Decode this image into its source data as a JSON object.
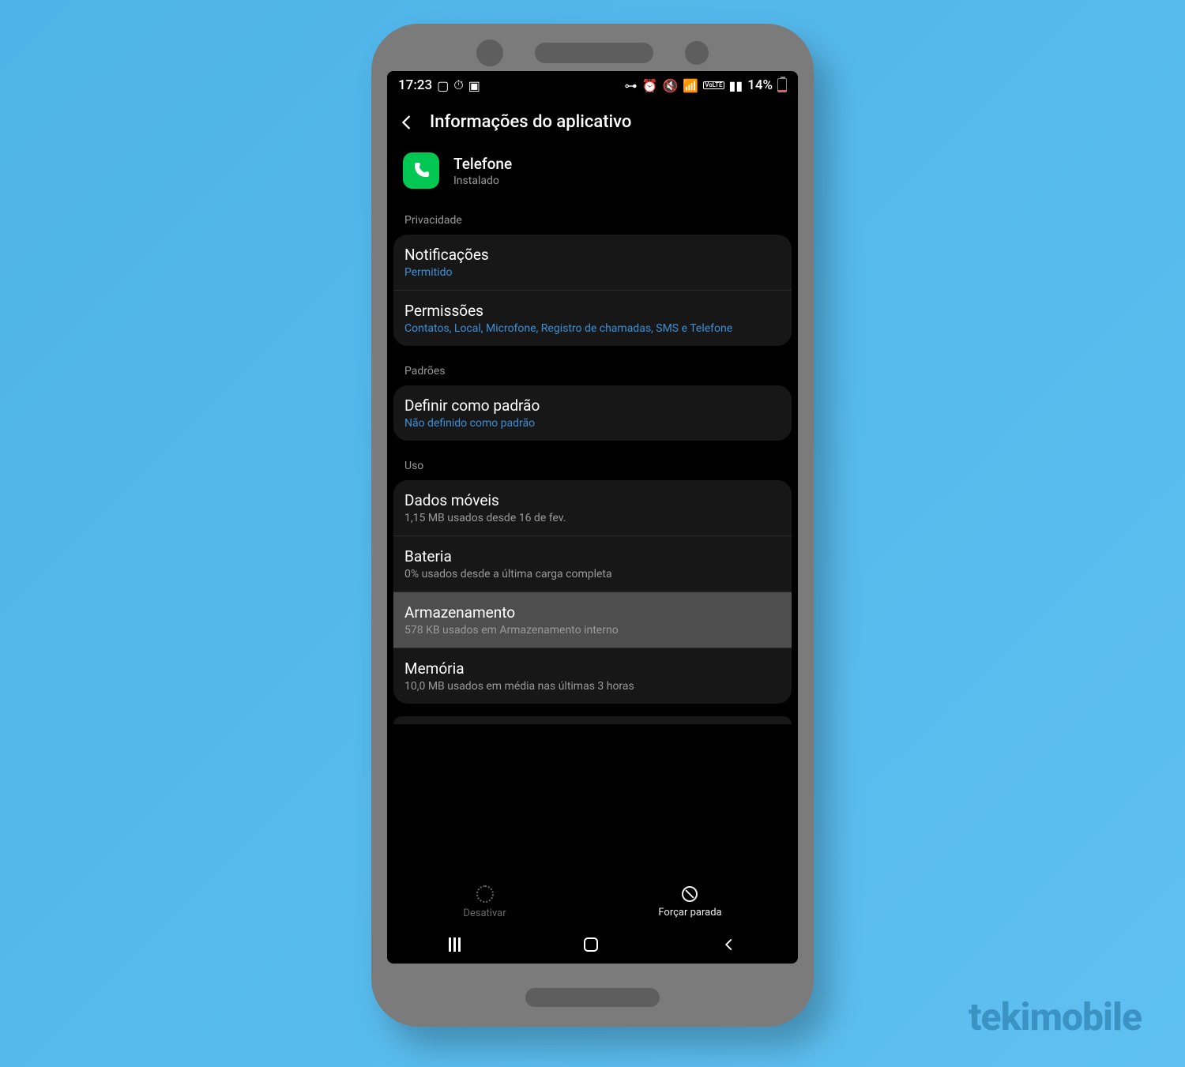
{
  "watermark": "tekimobile",
  "status_bar": {
    "time": "17:23",
    "battery_pct": "14%"
  },
  "header": {
    "title": "Informações do aplicativo"
  },
  "app": {
    "name": "Telefone",
    "status": "Instalado",
    "icon_glyph": "C"
  },
  "sections": {
    "privacy": {
      "label": "Privacidade",
      "rows": [
        {
          "title": "Notificações",
          "sub": "Permitido",
          "link": true
        },
        {
          "title": "Permissões",
          "sub": "Contatos, Local, Microfone, Registro de chamadas, SMS e Telefone",
          "link": true
        }
      ]
    },
    "defaults": {
      "label": "Padrões",
      "rows": [
        {
          "title": "Definir como padrão",
          "sub": "Não definido como padrão",
          "link": true
        }
      ]
    },
    "usage": {
      "label": "Uso",
      "rows": [
        {
          "title": "Dados móveis",
          "sub": "1,15 MB usados desde 16 de fev.",
          "link": false
        },
        {
          "title": "Bateria",
          "sub": "0% usados desde a última carga completa",
          "link": false
        },
        {
          "title": "Armazenamento",
          "sub": "578 KB usados em Armazenamento interno",
          "link": false,
          "highlight": true
        },
        {
          "title": "Memória",
          "sub": "10,0 MB usados em média nas últimas 3 horas",
          "link": false
        }
      ]
    }
  },
  "bottom": {
    "disable": "Desativar",
    "force_stop": "Forçar parada"
  }
}
